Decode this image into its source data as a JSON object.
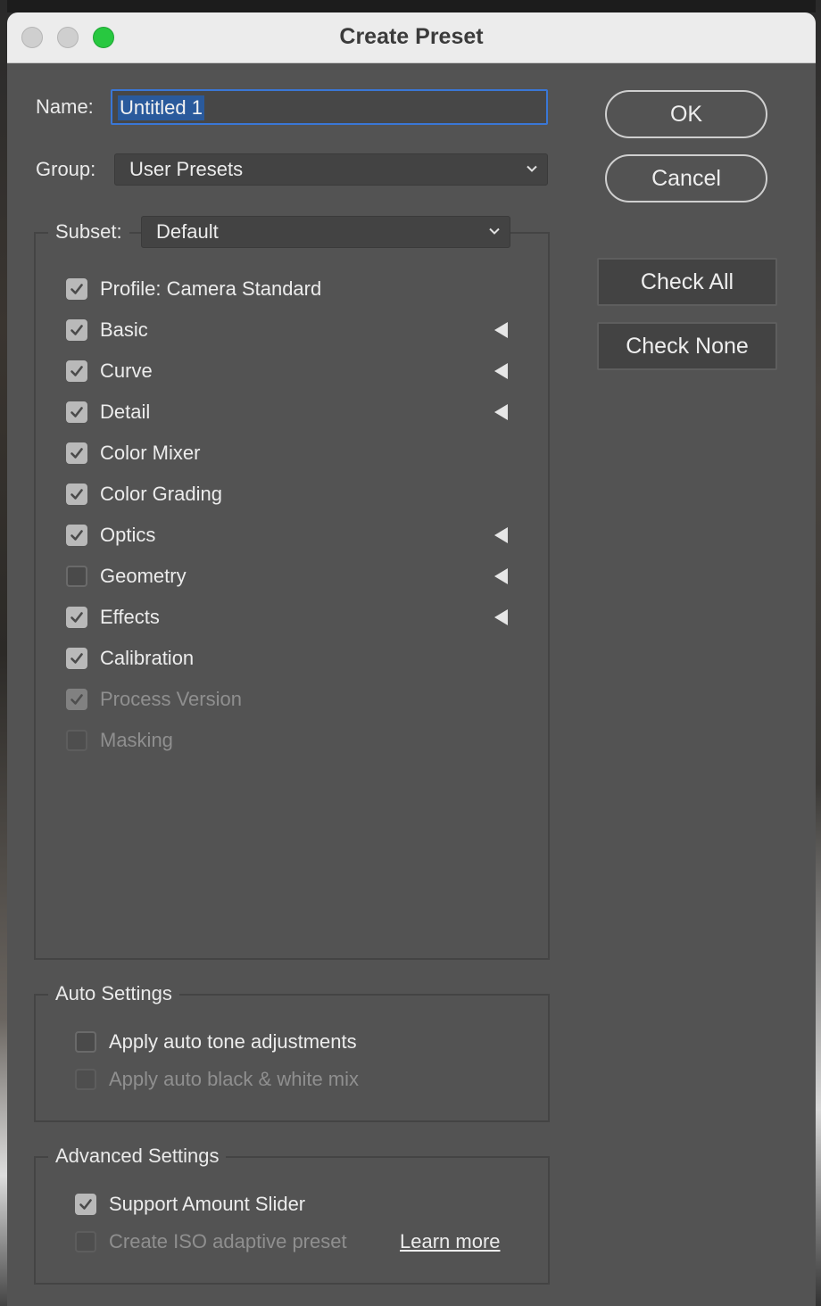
{
  "window": {
    "title": "Create Preset",
    "traffic_lights": [
      "close",
      "minimize",
      "zoom"
    ]
  },
  "name_field": {
    "label": "Name:",
    "value": "Untitled 1"
  },
  "group_field": {
    "label": "Group:",
    "value": "User Presets"
  },
  "subset_field": {
    "label": "Subset:",
    "value": "Default"
  },
  "buttons": {
    "ok": "OK",
    "cancel": "Cancel",
    "check_all": "Check All",
    "check_none": "Check None"
  },
  "settings": [
    {
      "label": "Profile: Camera Standard",
      "checked": true,
      "enabled": true,
      "expandable": false
    },
    {
      "label": "Basic",
      "checked": true,
      "enabled": true,
      "expandable": true
    },
    {
      "label": "Curve",
      "checked": true,
      "enabled": true,
      "expandable": true
    },
    {
      "label": "Detail",
      "checked": true,
      "enabled": true,
      "expandable": true
    },
    {
      "label": "Color Mixer",
      "checked": true,
      "enabled": true,
      "expandable": false
    },
    {
      "label": "Color Grading",
      "checked": true,
      "enabled": true,
      "expandable": false
    },
    {
      "label": "Optics",
      "checked": true,
      "enabled": true,
      "expandable": true
    },
    {
      "label": "Geometry",
      "checked": false,
      "enabled": true,
      "expandable": true
    },
    {
      "label": "Effects",
      "checked": true,
      "enabled": true,
      "expandable": true
    },
    {
      "label": "Calibration",
      "checked": true,
      "enabled": true,
      "expandable": false
    },
    {
      "label": "Process Version",
      "checked": true,
      "enabled": false,
      "expandable": false
    },
    {
      "label": "Masking",
      "checked": false,
      "enabled": false,
      "expandable": false
    }
  ],
  "auto_settings": {
    "legend": "Auto Settings",
    "items": [
      {
        "label": "Apply auto tone adjustments",
        "checked": false,
        "enabled": true
      },
      {
        "label": "Apply auto black & white mix",
        "checked": false,
        "enabled": false
      }
    ]
  },
  "advanced_settings": {
    "legend": "Advanced Settings",
    "items": [
      {
        "label": "Support Amount Slider",
        "checked": true,
        "enabled": true
      },
      {
        "label": "Create ISO adaptive preset",
        "checked": false,
        "enabled": false
      }
    ],
    "learn_more": "Learn more"
  },
  "colors": {
    "dialog_bg": "#535353",
    "focus_ring": "#3a77d6",
    "text_selection": "#2a5a9c",
    "zoom_button": "#28c840"
  }
}
